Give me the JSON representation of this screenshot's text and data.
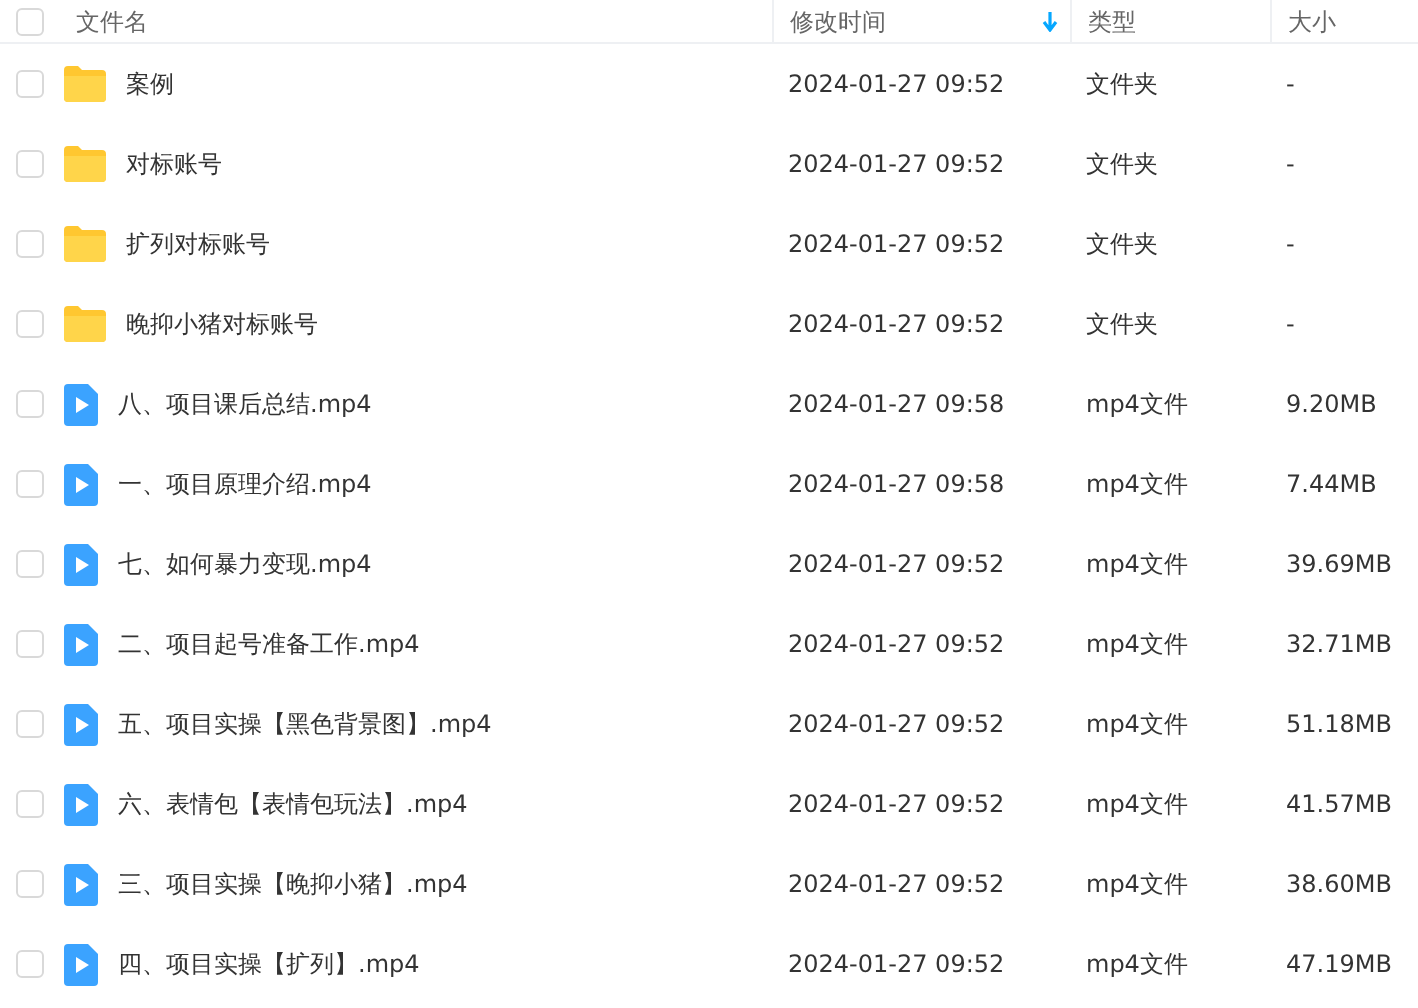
{
  "header": {
    "select_all": {
      "checked": false
    },
    "columns": [
      {
        "label": "文件名",
        "sorted": false
      },
      {
        "label": "修改时间",
        "sorted": true
      },
      {
        "label": "类型",
        "sorted": false
      },
      {
        "label": "大小",
        "sorted": false
      }
    ]
  },
  "files": [
    {
      "kind": "folder",
      "name": "案例",
      "modified": "2024-01-27 09:52",
      "type": "文件夹",
      "size": "-",
      "selected": false
    },
    {
      "kind": "folder",
      "name": "对标账号",
      "modified": "2024-01-27 09:52",
      "type": "文件夹",
      "size": "-",
      "selected": false
    },
    {
      "kind": "folder",
      "name": "扩列对标账号",
      "modified": "2024-01-27 09:52",
      "type": "文件夹",
      "size": "-",
      "selected": false
    },
    {
      "kind": "folder",
      "name": "晚抑小猪对标账号",
      "modified": "2024-01-27 09:52",
      "type": "文件夹",
      "size": "-",
      "selected": false
    },
    {
      "kind": "video",
      "name": "八、项目课后总结.mp4",
      "modified": "2024-01-27 09:58",
      "type": "mp4文件",
      "size": "9.20MB",
      "selected": false
    },
    {
      "kind": "video",
      "name": "一、项目原理介绍.mp4",
      "modified": "2024-01-27 09:58",
      "type": "mp4文件",
      "size": "7.44MB",
      "selected": false
    },
    {
      "kind": "video",
      "name": "七、如何暴力变现.mp4",
      "modified": "2024-01-27 09:52",
      "type": "mp4文件",
      "size": "39.69MB",
      "selected": false
    },
    {
      "kind": "video",
      "name": "二、项目起号准备工作.mp4",
      "modified": "2024-01-27 09:52",
      "type": "mp4文件",
      "size": "32.71MB",
      "selected": false
    },
    {
      "kind": "video",
      "name": "五、项目实操【黑色背景图】.mp4",
      "modified": "2024-01-27 09:52",
      "type": "mp4文件",
      "size": "51.18MB",
      "selected": false
    },
    {
      "kind": "video",
      "name": "六、表情包【表情包玩法】.mp4",
      "modified": "2024-01-27 09:52",
      "type": "mp4文件",
      "size": "41.57MB",
      "selected": false
    },
    {
      "kind": "video",
      "name": "三、项目实操【晚抑小猪】.mp4",
      "modified": "2024-01-27 09:52",
      "type": "mp4文件",
      "size": "38.60MB",
      "selected": false
    },
    {
      "kind": "video",
      "name": "四、项目实操【扩列】.mp4",
      "modified": "2024-01-27 09:52",
      "type": "mp4文件",
      "size": "47.19MB",
      "selected": false
    }
  ]
}
